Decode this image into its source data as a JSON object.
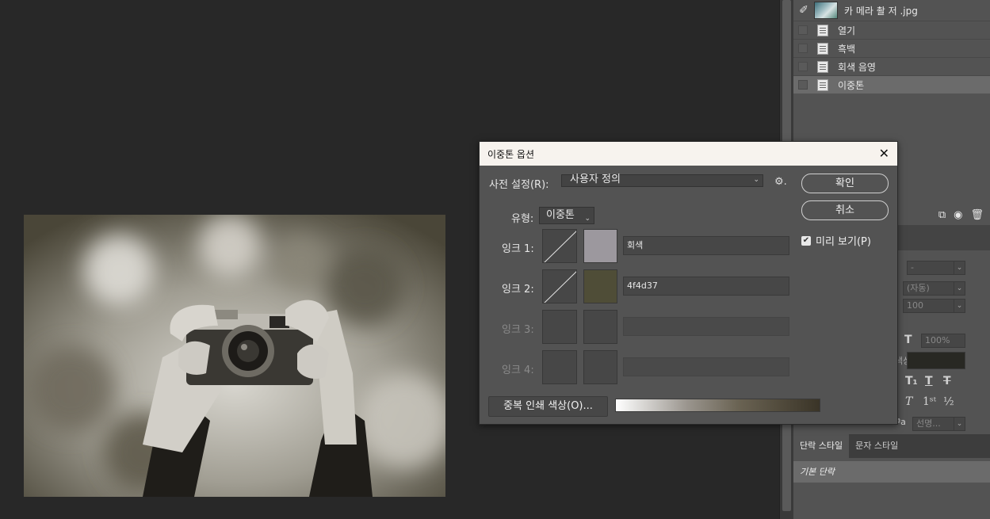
{
  "history": {
    "filename": "카 메라 촬 저 .jpg",
    "items": [
      {
        "label": "열기"
      },
      {
        "label": "흑백"
      },
      {
        "label": "회색 음영"
      },
      {
        "label": "이중톤"
      }
    ]
  },
  "dialog": {
    "title": "이중톤 옵션",
    "preset_label": "사전 설정(R):",
    "preset_value": "사용자 정의",
    "type_label": "유형:",
    "type_value": "이중톤",
    "inks": [
      {
        "label": "잉크 1:",
        "name": "회색",
        "color": "#9c989e",
        "enabled": true
      },
      {
        "label": "잉크 2:",
        "name": "4f4d37",
        "color": "#4f4d37",
        "enabled": true
      },
      {
        "label": "잉크 3:",
        "name": "",
        "color": "#474747",
        "enabled": false
      },
      {
        "label": "잉크 4:",
        "name": "",
        "color": "#474747",
        "enabled": false
      }
    ],
    "ok_label": "확인",
    "cancel_label": "취소",
    "preview_label": "미리 보기(P)",
    "overprint_label": "중복 인쇄 색상(O)..."
  },
  "character_panel": {
    "leading_value": "(자동)",
    "tracking_value": "100",
    "scale_value": "100%",
    "color_label": "색상:",
    "aa_value": "선명..."
  },
  "paragraph_panel": {
    "tabs": [
      "단락 스타일",
      "문자 스타일"
    ],
    "style_item": "기본 단락"
  }
}
